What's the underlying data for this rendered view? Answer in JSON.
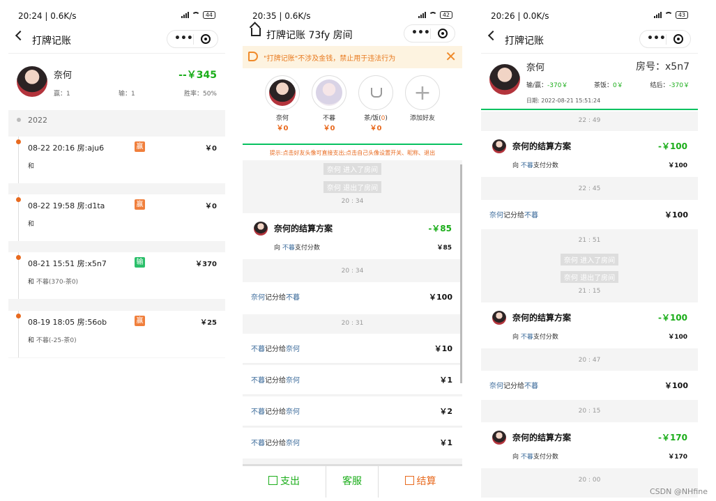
{
  "panel1": {
    "status": {
      "time": "20:24 | 0.6K/s",
      "battery": "44"
    },
    "nav": {
      "title": "打牌记账"
    },
    "profile": {
      "name": "奈何",
      "amount": "--￥345",
      "win": "赢：1",
      "lose": "输：1",
      "rate": "胜率：50%"
    },
    "year": "2022",
    "records": [
      {
        "head": "08-22 20:16 房:aju6",
        "badge": "赢",
        "amount": "￥0",
        "sub": "和",
        "detail": ""
      },
      {
        "head": "08-22 19:58 房:d1ta",
        "badge": "赢",
        "amount": "￥0",
        "sub": "和",
        "detail": ""
      },
      {
        "head": "08-21 15:51 房:x5n7",
        "badge": "输",
        "amount": "￥370",
        "sub": "和",
        "detail": "不暮(370-茶0)"
      },
      {
        "head": "08-19 18:05 房:56ob",
        "badge": "赢",
        "amount": "￥25",
        "sub": "和",
        "detail": "不暮(-25-茶0)"
      }
    ]
  },
  "panel2": {
    "status": {
      "time": "20:35 | 0.6K/s",
      "battery": "42"
    },
    "nav": {
      "title": "打牌记账 73fy 房间"
    },
    "notice": "\"打牌记账\"不涉及金钱，禁止用于违法行为",
    "friends": [
      {
        "name": "奈何",
        "value": "￥0"
      },
      {
        "name": "不暮",
        "value": "￥0"
      },
      {
        "name_prefix": "茶/饭(",
        "name_count": "0",
        "name_suffix": ")",
        "value": "￥0"
      },
      {
        "name": "添加好友"
      }
    ],
    "tip": "提示:点击好友头像可直接支出;点击自己头像设置开关、昵称、退出",
    "system": [
      "奈何 进入了房间",
      "奈何 退出了房间"
    ],
    "times": [
      "20 : 34",
      "20 : 34",
      "20 : 31"
    ],
    "settle": {
      "title": "奈何的结算方案",
      "amount": "-￥85",
      "sub_pre": "向 ",
      "sub_who": "不暮",
      "sub_post": "支付分数",
      "value": "￥85"
    },
    "transfers": [
      {
        "from": "奈何",
        "mid": "记分给",
        "to": "不暮",
        "amount": "￥100"
      },
      {
        "from": "不暮",
        "mid": "记分给",
        "to": "奈何",
        "amount": "￥10"
      },
      {
        "from": "不暮",
        "mid": "记分给",
        "to": "奈何",
        "amount": "￥1"
      },
      {
        "from": "不暮",
        "mid": "记分给",
        "to": "奈何",
        "amount": "￥2"
      },
      {
        "from": "不暮",
        "mid": "记分给",
        "to": "奈何",
        "amount": "￥1"
      }
    ],
    "tabs": {
      "pay": "支出",
      "service": "客服",
      "settle": "结算"
    }
  },
  "panel3": {
    "status": {
      "time": "20:26 | 0.0K/s",
      "battery": "43"
    },
    "nav": {
      "title": "打牌记账"
    },
    "header": {
      "name": "奈何",
      "room": "房号：x5n7",
      "lose_win": "输/赢：",
      "lose_win_val": "-370￥",
      "tea": "茶饭：",
      "tea_val": "0￥",
      "result": "结后：",
      "result_val": "-370￥",
      "date": "日期: 2022-08-21 15:51:24"
    },
    "times": [
      "22 : 49",
      "22 : 45",
      "21 : 51",
      "21 : 15",
      "20 : 47",
      "20 : 15",
      "20 : 00"
    ],
    "system": [
      "奈何 进入了房间",
      "奈何 退出了房间"
    ],
    "settles": [
      {
        "title": "奈何的结算方案",
        "amount": "-￥100",
        "sub_pre": "向 ",
        "sub_who": "不暮",
        "sub_post": "支付分数",
        "value": "￥100"
      },
      {
        "title": "奈何的结算方案",
        "amount": "-￥100",
        "sub_pre": "向 ",
        "sub_who": "不暮",
        "sub_post": "支付分数",
        "value": "￥100"
      },
      {
        "title": "奈何的结算方案",
        "amount": "-￥170",
        "sub_pre": "向 ",
        "sub_who": "不暮",
        "sub_post": "支付分数",
        "value": "￥170"
      }
    ],
    "transfers": [
      {
        "from": "奈何",
        "mid": "记分给",
        "to": "不暮",
        "amount": "￥100"
      },
      {
        "from": "奈何",
        "mid": "记分给",
        "to": "不暮",
        "amount": "￥100"
      }
    ]
  },
  "watermark": "CSDN @NHfine",
  "colors": {
    "green": "#1aad19",
    "orange": "#e86a1f",
    "win_badge": "#f07f3c",
    "lose_badge": "#2bbf6a",
    "link": "#3a6a9a"
  }
}
